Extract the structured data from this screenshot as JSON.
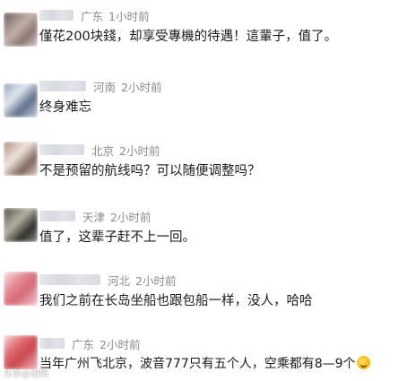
{
  "comments": [
    {
      "location": "广东",
      "time": "1小时前",
      "text": "僅花200块錢，却享受專機的待遇！這輩子，值了。",
      "avatar_colors": [
        "#6e5a58",
        "#c2b0aa",
        "#8a7670",
        "#d9cfcb"
      ]
    },
    {
      "location": "河南",
      "time": "2小时前",
      "text": "终身难忘",
      "avatar_colors": [
        "#8fa0b8",
        "#c9d3e1",
        "#5e6f8a",
        "#e3e8f0"
      ]
    },
    {
      "location": "北京",
      "time": "2小时前",
      "text": "不是预留的航线吗？可以随便调整吗？",
      "avatar_colors": [
        "#b08a7a",
        "#e0cfc6",
        "#7f6459",
        "#f0e6e0"
      ]
    },
    {
      "location": "天津",
      "time": "2小时前",
      "text": "值了，这辈子赶不上一回。",
      "avatar_colors": [
        "#4b4a45",
        "#8c8a7d",
        "#2f2e2a",
        "#b7b3a3"
      ]
    },
    {
      "location": "河北",
      "time": "2小时前",
      "text": "我们之前在长岛坐船也跟包船一样，没人，哈哈",
      "avatar_colors": [
        "#e58a93",
        "#f6c9cf",
        "#d46a78",
        "#fbe4e7"
      ]
    },
    {
      "location": "广东",
      "time": "2小时前",
      "text": "当年广州飞北京，波音777只有五个人，空乘都有8—9个",
      "avatar_colors": [
        "#e06a6f",
        "#f2b8bc",
        "#c9484f",
        "#f8dadc"
      ]
    }
  ],
  "watermark": "头条@谢娟"
}
